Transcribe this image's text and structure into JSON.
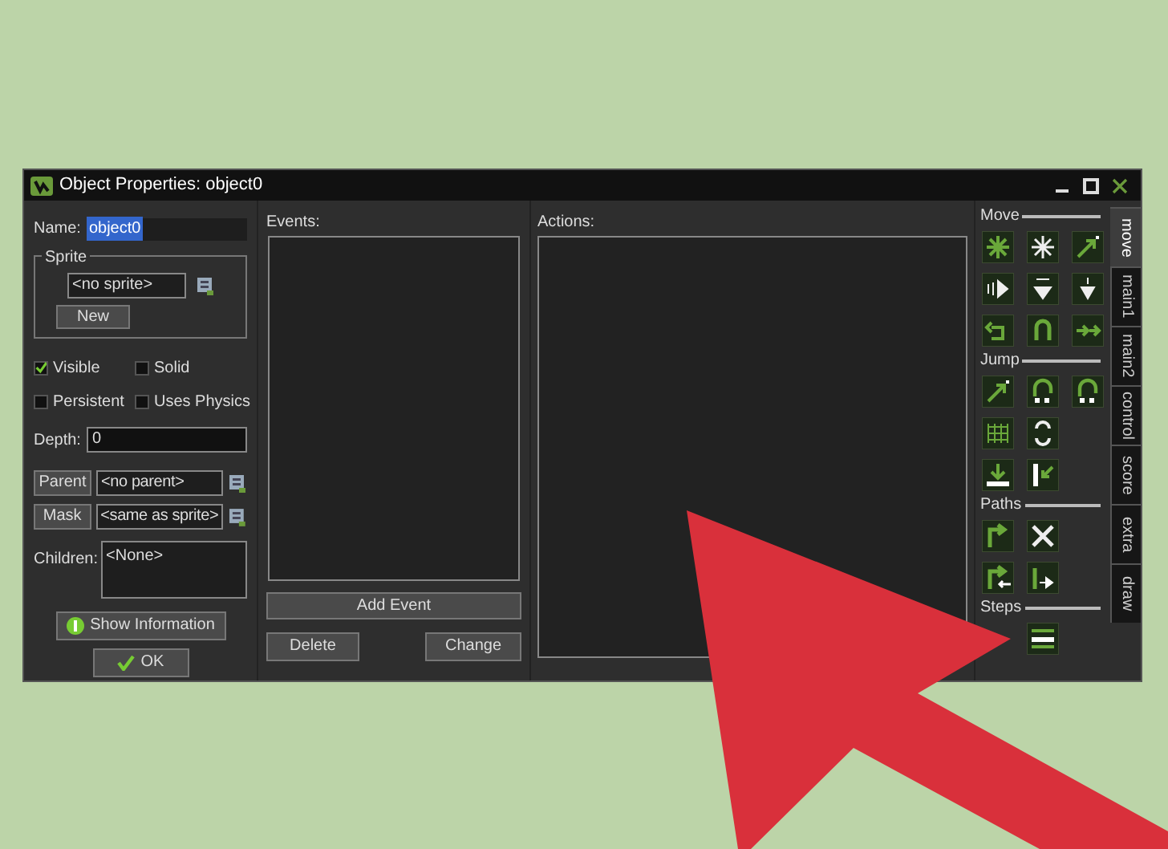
{
  "window": {
    "title": "Object Properties: object0"
  },
  "name": {
    "label": "Name:",
    "value": "object0"
  },
  "sprite": {
    "group": "Sprite",
    "value": "<no sprite>",
    "button": "New"
  },
  "flags": [
    {
      "label": "Visible",
      "checked": true
    },
    {
      "label": "Solid",
      "checked": false
    },
    {
      "label": "Persistent",
      "checked": false
    },
    {
      "label": "Uses Physics",
      "checked": false
    }
  ],
  "depth": {
    "label": "Depth:",
    "value": "0"
  },
  "parent": {
    "button": "Parent",
    "value": "<no parent>"
  },
  "mask": {
    "button": "Mask",
    "value": "<same as sprite>"
  },
  "children": {
    "label": "Children:",
    "value": "<None>"
  },
  "show_information": "Show Information",
  "ok": "OK",
  "events": {
    "label": "Events:",
    "add": "Add Event",
    "delete": "Delete",
    "change": "Change"
  },
  "actions": {
    "label": "Actions:"
  },
  "palette_sections": [
    "Move",
    "Jump",
    "Paths",
    "Steps"
  ],
  "tabs": [
    {
      "label": "move",
      "selected": true
    },
    {
      "label": "main1",
      "selected": false
    },
    {
      "label": "main2",
      "selected": false
    },
    {
      "label": "control",
      "selected": false
    },
    {
      "label": "score",
      "selected": false
    },
    {
      "label": "extra",
      "selected": false
    },
    {
      "label": "draw",
      "selected": false
    }
  ]
}
